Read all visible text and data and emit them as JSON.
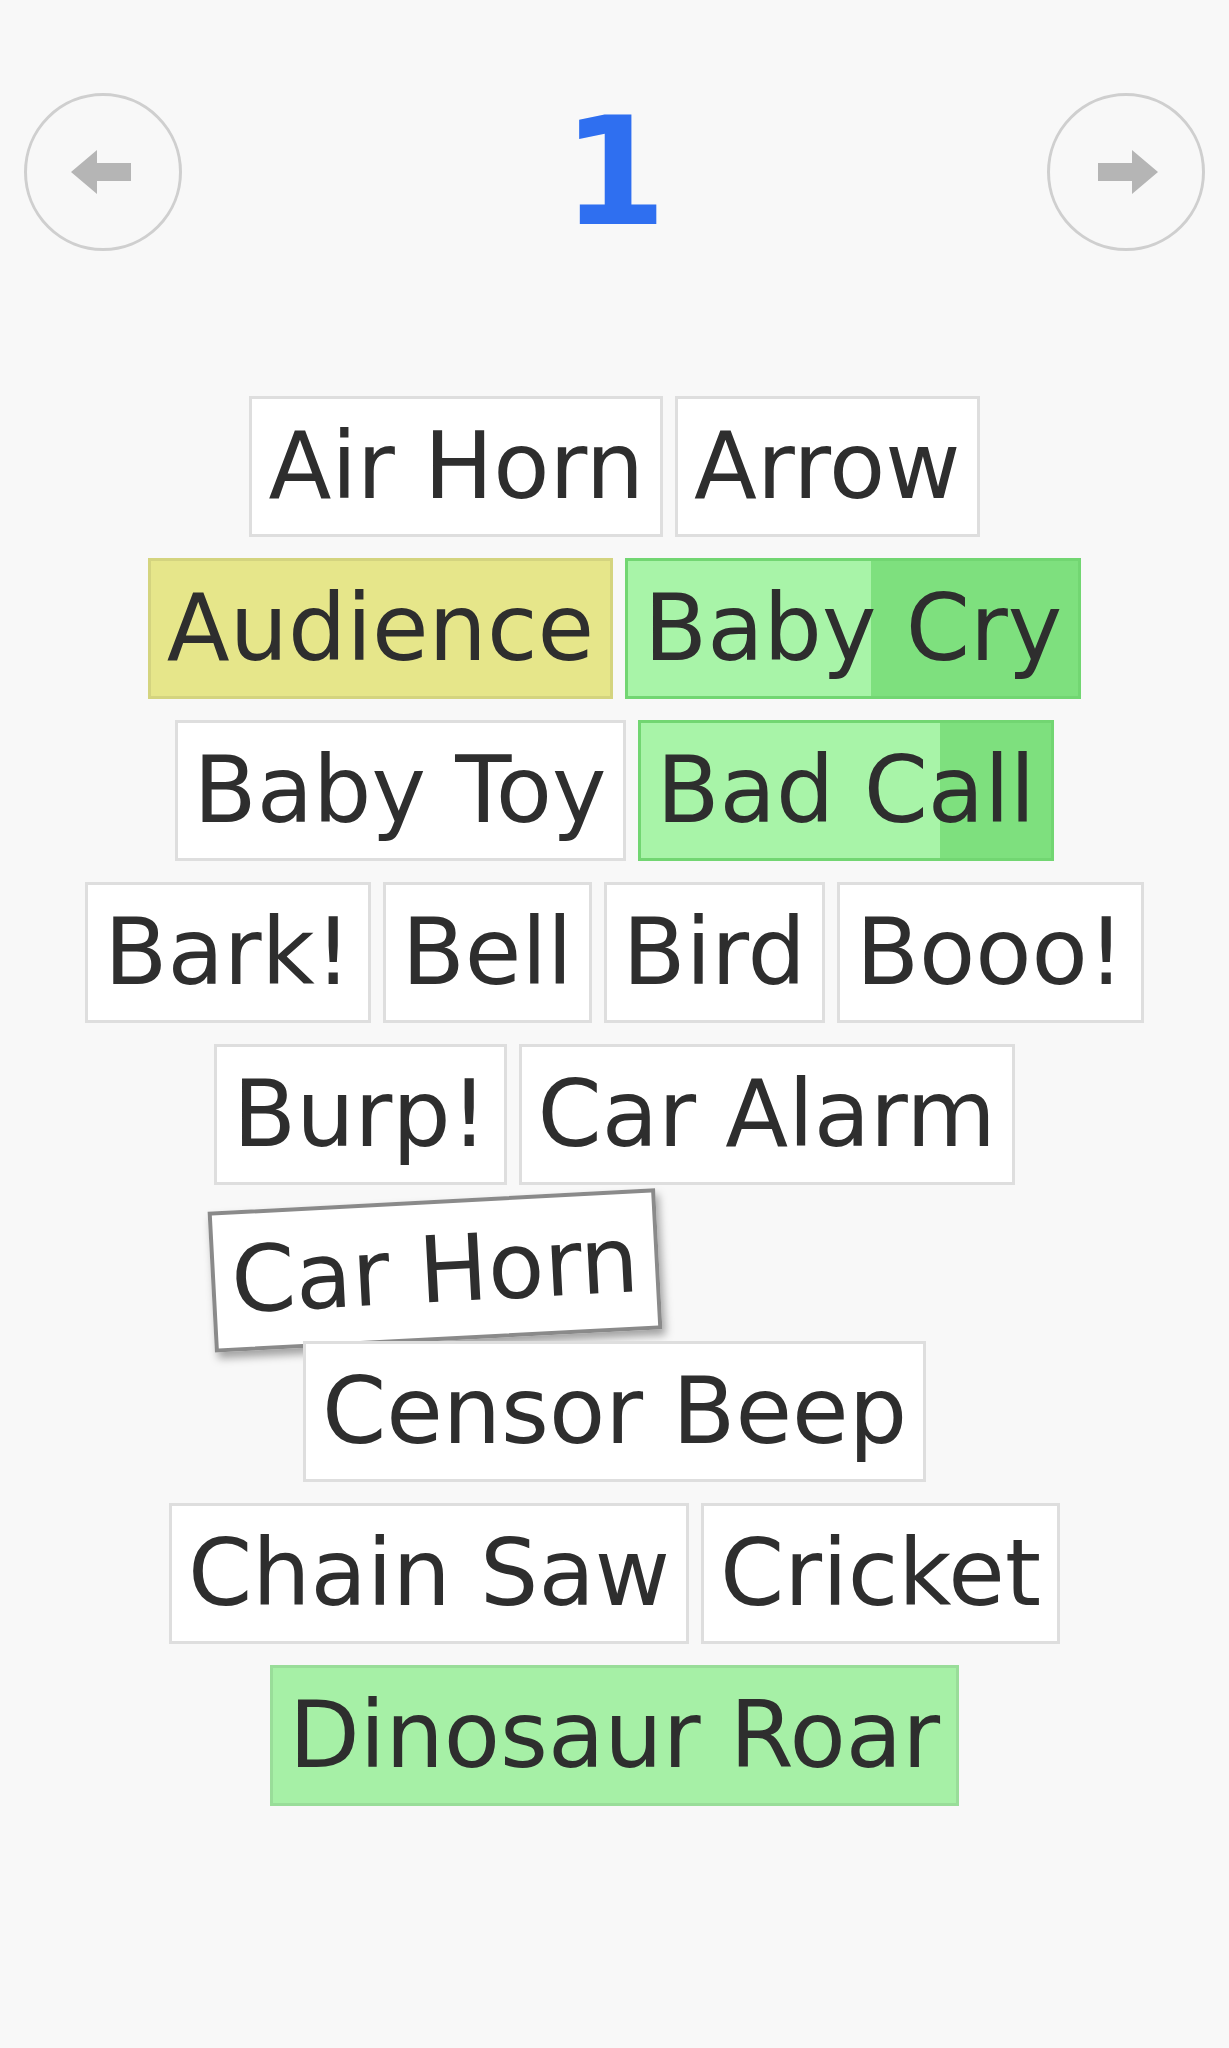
{
  "header": {
    "page_number": "1"
  },
  "rows": [
    [
      {
        "label": "Air Horn",
        "kind": "plain"
      },
      {
        "label": "Arrow",
        "kind": "plain"
      }
    ],
    [
      {
        "label": "Audience",
        "kind": "tinted",
        "color": "#e6e68a"
      },
      {
        "label": "Baby Cry",
        "kind": "playing",
        "level": 0.54
      }
    ],
    [
      {
        "label": "Baby Toy",
        "kind": "plain"
      },
      {
        "label": "Bad Call",
        "kind": "playing",
        "level": 0.73
      }
    ],
    [
      {
        "label": "Bark!",
        "kind": "plain"
      },
      {
        "label": "Bell",
        "kind": "plain"
      },
      {
        "label": "Bird",
        "kind": "plain"
      },
      {
        "label": "Booo!",
        "kind": "plain"
      }
    ],
    [
      {
        "label": "Burp!",
        "kind": "plain"
      },
      {
        "label": "Car Alarm",
        "kind": "plain"
      }
    ],
    [
      {
        "label": "Car Horn",
        "kind": "dragging"
      }
    ],
    [
      {
        "label": "Censor Beep",
        "kind": "plain"
      }
    ],
    [
      {
        "label": "Chain Saw",
        "kind": "plain"
      },
      {
        "label": "Cricket",
        "kind": "plain"
      }
    ],
    [
      {
        "label": "Dinosaur Roar",
        "kind": "tinted",
        "color": "#a6f0a6"
      }
    ]
  ]
}
